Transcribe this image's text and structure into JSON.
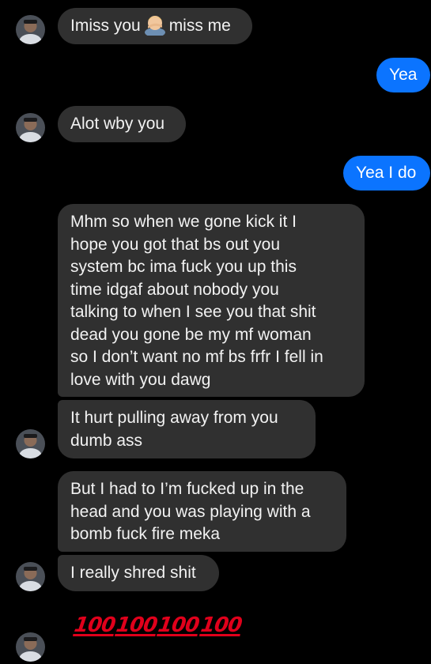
{
  "colors": {
    "background": "#000000",
    "incoming_bubble": "#303030",
    "outgoing_bubble": "#0b74ff",
    "emoji_100": "#e0001b"
  },
  "messages": [
    {
      "id": "m1",
      "direction": "incoming",
      "text_before": "Imiss you",
      "emoji": "man-facepalming-emoji",
      "text_after": "miss me"
    },
    {
      "id": "m2",
      "direction": "outgoing",
      "text": "Yea"
    },
    {
      "id": "m3",
      "direction": "incoming",
      "text": "Alot wby you"
    },
    {
      "id": "m4",
      "direction": "outgoing",
      "text": "Yea I do"
    },
    {
      "id": "m5",
      "direction": "incoming",
      "lines": [
        "Mhm so when we gone kick it I",
        "hope you got that bs out you",
        "system bc ima fuck you up this",
        "time idgaf about nobody you",
        "talking to when I see you that shit",
        "dead you gone be my mf woman",
        "so I don’t want no mf bs frfr I fell in",
        "love with you dawg"
      ]
    },
    {
      "id": "m6",
      "direction": "incoming",
      "lines": [
        "It hurt pulling away from you",
        "dumb ass"
      ]
    },
    {
      "id": "m7",
      "direction": "incoming",
      "lines": [
        "But I had to I’m fucked up in the",
        "head and you was playing with a",
        "bomb fuck fire meka"
      ]
    },
    {
      "id": "m8",
      "direction": "incoming",
      "text": "I really shred shit"
    },
    {
      "id": "m9",
      "direction": "incoming",
      "emojis": [
        "100",
        "100",
        "100",
        "100"
      ],
      "emoji_name": "hundred-points-emoji"
    }
  ],
  "avatar": {
    "icon": "contact-avatar"
  }
}
